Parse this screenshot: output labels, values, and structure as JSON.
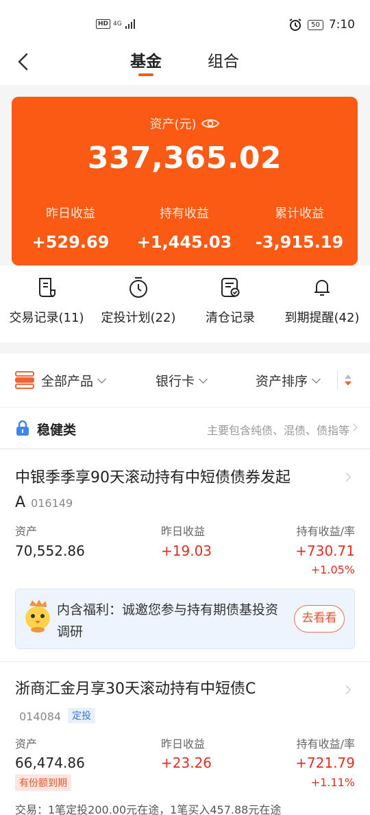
{
  "status_bar": {
    "network": "4G",
    "hd": "HD",
    "battery": "50",
    "time": "7:10"
  },
  "nav": {
    "tabs": [
      "基金",
      "组合"
    ]
  },
  "assets": {
    "label": "资产(元)",
    "total": "337,365.02",
    "stats": [
      {
        "label": "昨日收益",
        "value": "+529.69"
      },
      {
        "label": "持有收益",
        "value": "+1,445.03"
      },
      {
        "label": "累计收益",
        "value": "-3,915.19"
      }
    ]
  },
  "shortcuts": [
    "交易记录(11)",
    "定投计划(22)",
    "清仓记录",
    "到期提醒(42)"
  ],
  "filters": [
    "全部产品",
    "银行卡",
    "资产排序"
  ],
  "category": {
    "title": "稳健类",
    "desc": "主要包含纯债、混债、债指等"
  },
  "funds": [
    {
      "name": "中银季季享90天滚动持有中短债债券发起A",
      "code": "016149",
      "headers": [
        "资产",
        "昨日收益",
        "持有收益/率"
      ],
      "asset": "70,552.86",
      "yesterday": "+19.03",
      "holding": "+730.71",
      "rate": "+1.05%",
      "promo": {
        "text": "内含福利：诚邀您参与持有期债基投资调研",
        "button": "去看看"
      }
    },
    {
      "name": "浙商汇金月享30天滚动持有中短债C",
      "code": "014084",
      "tag": "定投",
      "headers": [
        "资产",
        "昨日收益",
        "持有收益/率"
      ],
      "asset": "66,474.86",
      "badge": "有份额到期",
      "yesterday": "+23.26",
      "holding": "+721.79",
      "rate": "+1.11%",
      "trade": "交易：1笔定投200.00元在途，1笔买入457.88元在途"
    }
  ],
  "colors": {
    "accent": "#fa5a14",
    "rise": "#e12d22"
  }
}
